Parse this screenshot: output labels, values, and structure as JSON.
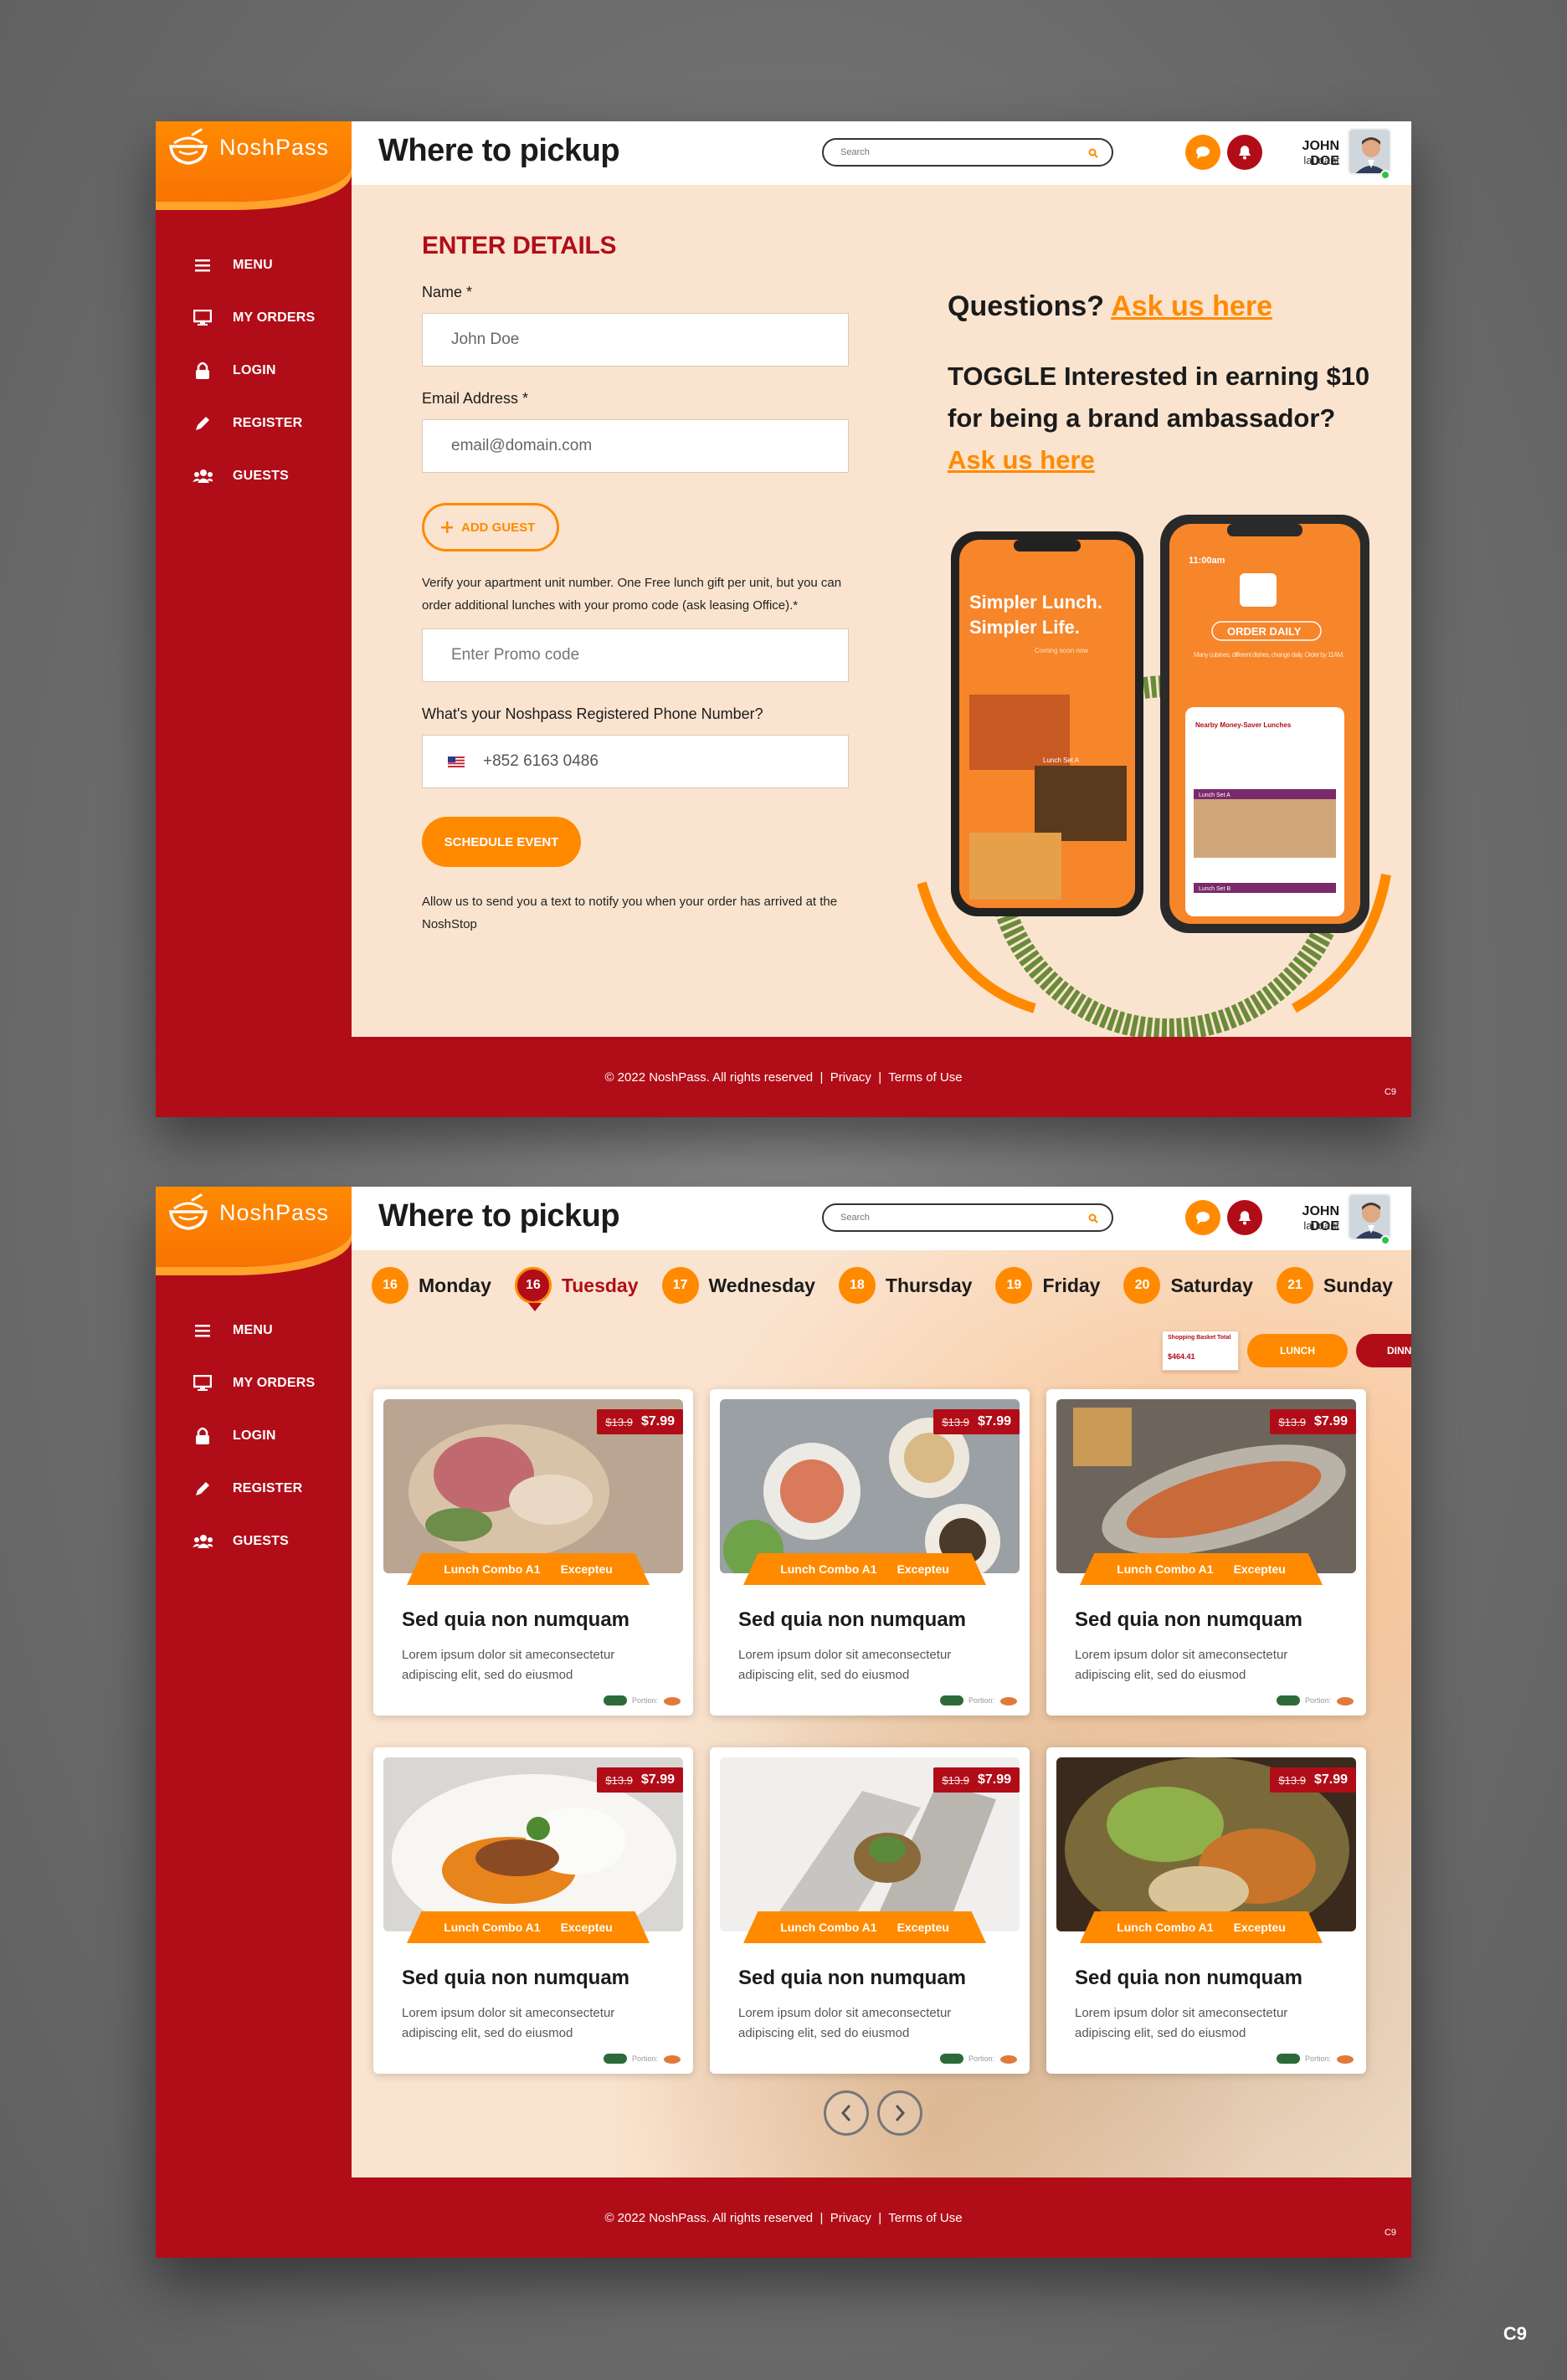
{
  "brand": {
    "name": "NoshPass",
    "primary": "#b10d18",
    "accent": "#ff8a00",
    "background": "#fae4cf"
  },
  "header": {
    "title": "Where to pickup",
    "search_placeholder": "Search",
    "user_name": "JOHN DOE",
    "user_role": "laudant",
    "icons": [
      "chat-icon",
      "bell-icon",
      "search-icon"
    ]
  },
  "sidebar": {
    "items": [
      {
        "label": "MENU",
        "icon": "hamburger-icon"
      },
      {
        "label": "MY ORDERS",
        "icon": "monitor-icon"
      },
      {
        "label": "LOGIN",
        "icon": "lock-icon"
      },
      {
        "label": "REGISTER",
        "icon": "pencil-icon"
      },
      {
        "label": "GUESTS",
        "icon": "users-icon"
      }
    ]
  },
  "form": {
    "section_title": "ENTER DETAILS",
    "name_label": "Name *",
    "name_value": "John Doe",
    "email_label": "Email Address *",
    "email_value": "email@domain.com",
    "add_guest_label": "ADD GUEST",
    "promo_hint": "Verify your apartment unit number. One Free lunch gift per unit, but you can order additional lunches with your promo code (ask leasing Office).*",
    "promo_placeholder": "Enter Promo code",
    "phone_label": "What's your Noshpass Registered Phone Number?",
    "phone_value": "+852 6163 0486",
    "schedule_label": "SCHEDULE EVENT",
    "notify_text": "Allow us to send you a text to notify you when your order has arrived at the NoshStop"
  },
  "aside": {
    "questions_prefix": "Questions?",
    "questions_link": "Ask us here",
    "ambassador_text": "TOGGLE Interested in earning $10 for being a brand ambassador?",
    "ambassador_link": "Ask us here"
  },
  "phone_promo": {
    "left_headline_1": "Simpler Lunch.",
    "left_headline_2": "Simpler Life.",
    "left_sub": "Coming soon now",
    "left_card_1": "Lunch Set A",
    "right_time": "11:00am",
    "right_title": "ORDER DAILY",
    "right_sub": "Many cuisines, different dishes, change daily. Order by 11AM.",
    "right_card_head": "Nearby Money-Saver Lunches",
    "right_card_1": "Lunch Set A",
    "right_card_2": "Lunch Set B"
  },
  "days": [
    {
      "num": "16",
      "name": "Monday",
      "active": false
    },
    {
      "num": "16",
      "name": "Tuesday",
      "active": true
    },
    {
      "num": "17",
      "name": "Wednesday",
      "active": false
    },
    {
      "num": "18",
      "name": "Thursday",
      "active": false
    },
    {
      "num": "19",
      "name": "Friday",
      "active": false
    },
    {
      "num": "20",
      "name": "Saturday",
      "active": false
    },
    {
      "num": "21",
      "name": "Sunday",
      "active": false
    }
  ],
  "meal_toggle": {
    "mini_card_head": "Shopping Basket Total",
    "mini_card_price": "$464.41",
    "lunch_label": "LUNCH",
    "dinner_label": "DINNER"
  },
  "cards": [
    {
      "old_price": "$13.9",
      "price": "$7.99",
      "combo": "Lunch Combo A1",
      "tag": "Excepteu",
      "title": "Sed quia non numquam",
      "desc": "Lorem ipsum dolor sit ameconsectetur adipiscing elit, sed do eiusmod",
      "portion": "Portion:"
    },
    {
      "old_price": "$13.9",
      "price": "$7.99",
      "combo": "Lunch Combo A1",
      "tag": "Excepteu",
      "title": "Sed quia non numquam",
      "desc": "Lorem ipsum dolor sit ameconsectetur adipiscing elit, sed do eiusmod",
      "portion": "Portion:"
    },
    {
      "old_price": "$13.9",
      "price": "$7.99",
      "combo": "Lunch Combo A1",
      "tag": "Excepteu",
      "title": "Sed quia non numquam",
      "desc": "Lorem ipsum dolor sit ameconsectetur adipiscing elit, sed do eiusmod",
      "portion": "Portion:"
    },
    {
      "old_price": "$13.9",
      "price": "$7.99",
      "combo": "Lunch Combo A1",
      "tag": "Excepteu",
      "title": "Sed quia non numquam",
      "desc": "Lorem ipsum dolor sit ameconsectetur adipiscing elit, sed do eiusmod",
      "portion": "Portion:"
    },
    {
      "old_price": "$13.9",
      "price": "$7.99",
      "combo": "Lunch Combo A1",
      "tag": "Excepteu",
      "title": "Sed quia non numquam",
      "desc": "Lorem ipsum dolor sit ameconsectetur adipiscing elit, sed do eiusmod",
      "portion": "Portion:"
    },
    {
      "old_price": "$13.9",
      "price": "$7.99",
      "combo": "Lunch Combo A1",
      "tag": "Excepteu",
      "title": "Sed quia non numquam",
      "desc": "Lorem ipsum dolor sit ameconsectetur adipiscing elit, sed do eiusmod",
      "portion": "Portion:"
    }
  ],
  "footer": {
    "copyright": "© 2022 NoshPass. All rights reserved",
    "privacy": "Privacy",
    "terms": "Terms of Use",
    "code": "C9"
  },
  "corner_code": "C9"
}
